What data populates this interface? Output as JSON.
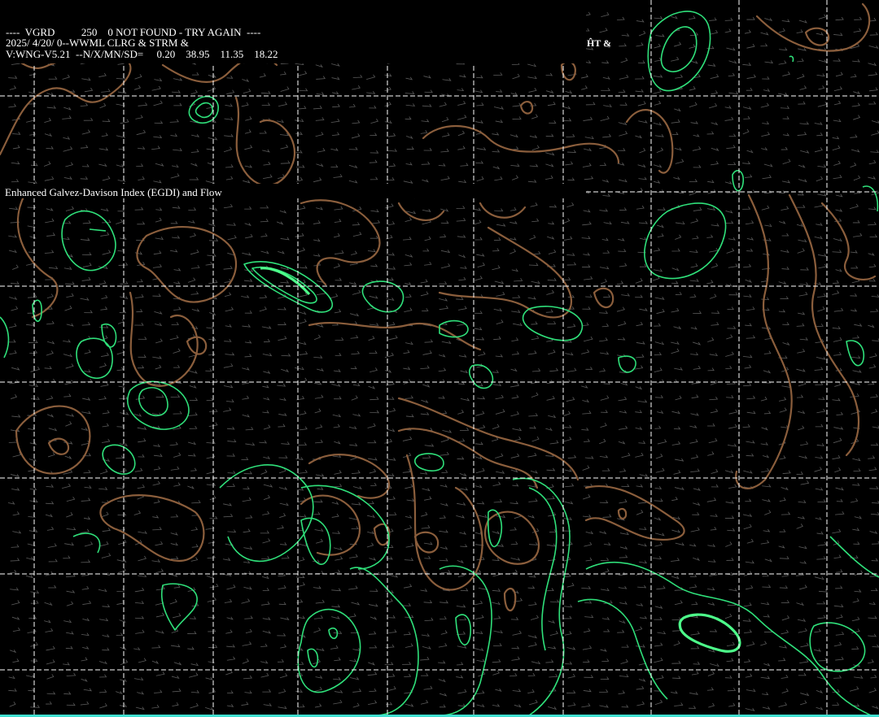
{
  "header": {
    "line1": "----  VGRD          250    0 NOT FOUND - TRY AGAIN  ----",
    "line2": "2025/ 4/20/ 0--WWML CLRG & STRM &",
    "line3": "V:WNG-V5.21  --N/X/MN/SD=     0.20    38.95    11.35    18.22",
    "corner_text": "ĤT &"
  },
  "product_title": "Enhanced Galvez-Davison Index (EGDI) and Flow",
  "colors": {
    "background": "#000000",
    "grid": "#ffffff",
    "wind_barbs": "#5a5a5a",
    "contour_brown": "#8b5e3c",
    "contour_green": "#2fe07a",
    "contour_green_bright": "#4dff8a",
    "bottom_bar": "#40e0d0",
    "text": "#ffffff"
  },
  "legend_values": {
    "N": 0.2,
    "X": 38.95,
    "MN": 11.35,
    "SD": 18.22
  }
}
